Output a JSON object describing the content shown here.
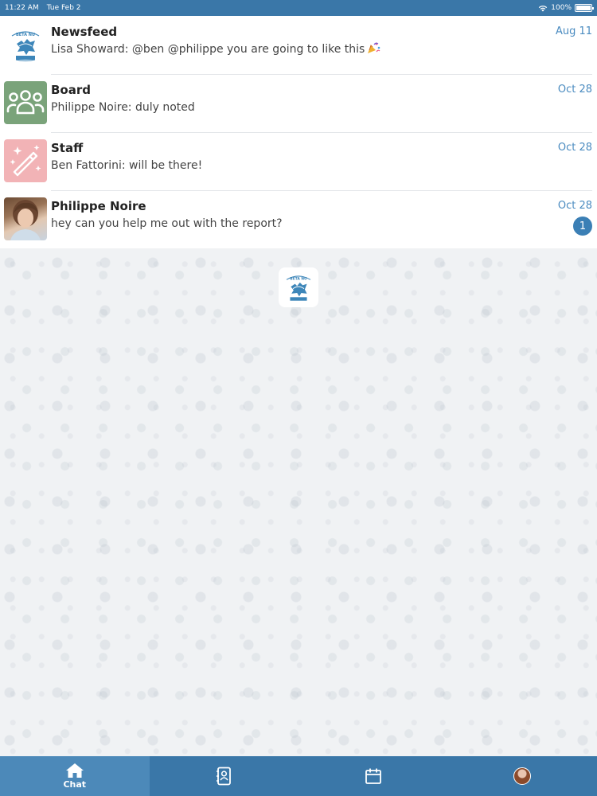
{
  "status_bar": {
    "time": "11:22 AM",
    "date": "Tue Feb 2",
    "battery": "100%"
  },
  "chats": [
    {
      "name": "Newsfeed",
      "preview": "Lisa Showard: @ben @philippe you are going to like this",
      "date": "Aug 11",
      "avatar_icon": "org-logo-icon",
      "unread": ""
    },
    {
      "name": "Board",
      "preview": "Philippe Noire: duly noted",
      "date": "Oct 28",
      "avatar_icon": "group-people-icon",
      "unread": ""
    },
    {
      "name": "Staff",
      "preview": "Ben Fattorini: will be there!",
      "date": "Oct 28",
      "avatar_icon": "magic-wand-icon",
      "unread": ""
    },
    {
      "name": "Philippe Noire",
      "preview": "hey can you help me out with the report?",
      "date": "Oct 28",
      "avatar_icon": "person-photo",
      "unread": "1"
    }
  ],
  "tabs": [
    {
      "label": "Chat",
      "icon": "home-icon",
      "active": true
    },
    {
      "label": "",
      "icon": "contacts-icon",
      "active": false
    },
    {
      "label": "",
      "icon": "calendar-icon",
      "active": false
    },
    {
      "label": "",
      "icon": "profile-avatar",
      "active": false
    }
  ],
  "colors": {
    "bar": "#3a77a8",
    "accent": "#4a8bc0",
    "board": "#7aa37a",
    "staff": "#f2b3b6"
  }
}
